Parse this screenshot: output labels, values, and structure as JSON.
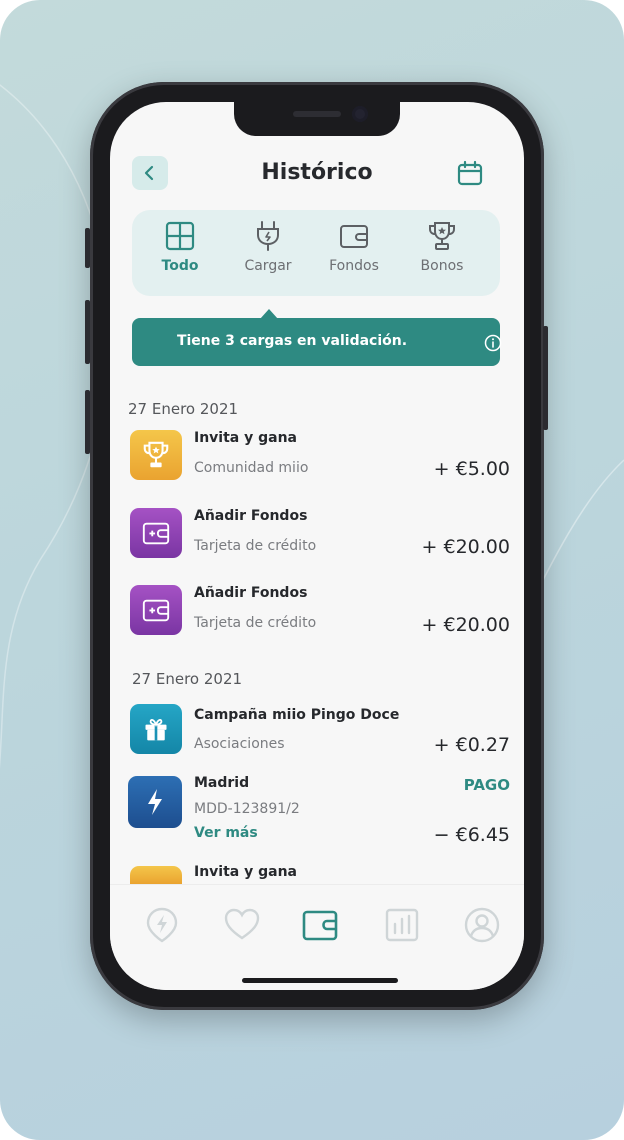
{
  "header": {
    "title": "Histórico",
    "back_icon": "chevron-left-icon",
    "calendar_icon": "calendar-icon"
  },
  "tabs": [
    {
      "label": "Todo",
      "icon": "grid-icon",
      "active": true
    },
    {
      "label": "Cargar",
      "icon": "plug-icon",
      "active": false
    },
    {
      "label": "Fondos",
      "icon": "wallet-icon",
      "active": false
    },
    {
      "label": "Bonos",
      "icon": "trophy-icon",
      "active": false
    }
  ],
  "banner": {
    "text": "Tiene 3 cargas en validación.",
    "icon": "info-icon"
  },
  "groups": [
    {
      "date": "27 Enero 2021",
      "items": [
        {
          "title": "Invita y gana",
          "subtitle": "Comunidad miio",
          "amount": "+ €5.00",
          "icon": "trophy-icon"
        },
        {
          "title": "Añadir Fondos",
          "subtitle": "Tarjeta de crédito",
          "amount": "+ €20.00",
          "icon": "wallet-add-icon"
        },
        {
          "title": "Añadir Fondos",
          "subtitle": "Tarjeta de crédito",
          "amount": "+ €20.00",
          "icon": "wallet-add-icon"
        }
      ]
    },
    {
      "date": "27 Enero 2021",
      "items": [
        {
          "title": "Campaña miio Pingo Doce",
          "subtitle": "Asociaciones",
          "amount": "+ €0.27",
          "icon": "gift-icon"
        },
        {
          "title": "Madrid",
          "subtitle": "MDD-123891/2",
          "status": "PAGO",
          "link": "Ver más",
          "amount": "− €6.45",
          "icon": "bolt-icon"
        },
        {
          "title": "Invita y gana",
          "icon": "trophy-icon"
        }
      ]
    }
  ],
  "bottom_nav": [
    {
      "icon": "charge-location-icon",
      "active": false
    },
    {
      "icon": "heart-icon",
      "active": false
    },
    {
      "icon": "wallet-icon",
      "active": true
    },
    {
      "icon": "stats-icon",
      "active": false
    },
    {
      "icon": "profile-icon",
      "active": false
    }
  ],
  "colors": {
    "accent": "#2e8a82",
    "tabs_bg": "#e3f0f0",
    "background": "#f7f7f7"
  }
}
